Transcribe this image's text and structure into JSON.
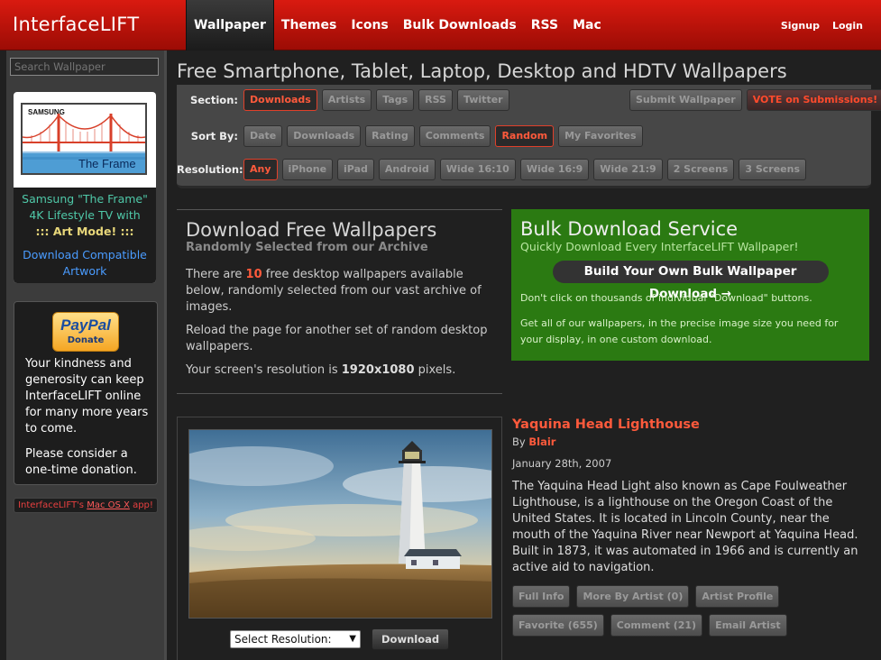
{
  "header": {
    "logo": "InterfaceLIFT",
    "nav": [
      "Wallpaper",
      "Themes",
      "Icons",
      "Bulk Downloads",
      "RSS",
      "Mac"
    ],
    "signup": "Signup",
    "login": "Login"
  },
  "sidebar": {
    "search_placeholder": "Search Wallpaper",
    "ad": {
      "brand": "SAMSUNG",
      "product": "The Frame",
      "line1": "Samsung \"The Frame\"",
      "line2": "4K Lifestyle TV with",
      "line3": "::: Art Mode! :::",
      "link": "Download Compatible Artwork"
    },
    "paypal": {
      "logo": "PayPal",
      "donate": "Donate"
    },
    "donate_p1": "Your kindness and generosity can keep InterfaceLIFT online for many more years to come.",
    "donate_p2": "Please consider a one-time donation.",
    "mac_prefix": "InterfaceLIFT's ",
    "mac_link": "Mac OS X",
    "mac_suffix": " app!"
  },
  "page_title": "Free Smartphone, Tablet, Laptop, Desktop and HDTV Wallpapers",
  "filters": {
    "section_label": "Section:",
    "section": [
      "Downloads",
      "Artists",
      "Tags",
      "RSS",
      "Twitter"
    ],
    "submit": "Submit Wallpaper",
    "vote": "VOTE on Submissions!",
    "sort_label": "Sort By:",
    "sort": [
      "Date",
      "Downloads",
      "Rating",
      "Comments",
      "Random",
      "My Favorites"
    ],
    "res_label": "Resolution:",
    "resolution": [
      "Any",
      "iPhone",
      "iPad",
      "Android",
      "Wide 16:10",
      "Wide 16:9",
      "Wide 21:9",
      "2 Screens",
      "3 Screens"
    ]
  },
  "intro": {
    "title": "Download Free Wallpapers",
    "subtitle": "Randomly Selected from our Archive",
    "p1_a": "There are ",
    "p1_num": "10",
    "p1_b": " free desktop wallpapers available below, randomly selected from our vast archive of images.",
    "p2": "Reload the page for another set of random desktop wallpapers.",
    "p3_a": "Your screen's resolution is ",
    "p3_res": "1920x1080",
    "p3_b": " pixels."
  },
  "bulk": {
    "title": "Bulk Download Service",
    "subtitle": "Quickly Download Every InterfaceLIFT Wallpaper!",
    "button": "Build Your Own Bulk Wallpaper Download →",
    "p1": "Don't click on thousands of individual \"Download\" buttons.",
    "p2": "Get all of our wallpapers, in the precise image size you need for your display, in one custom download."
  },
  "wallpaper": {
    "select_label": "Select Resolution:",
    "download": "Download",
    "title": "Yaquina Head Lighthouse",
    "by": "By ",
    "author": "Blair",
    "date": "January 28th, 2007",
    "description": "The Yaquina Head Light also known as Cape Foulweather Lighthouse, is a lighthouse on the Oregon Coast of the United States. It is located in Lincoln County, near the mouth of the Yaquina River near Newport at Yaquina Head. Built in 1873, it was automated in 1966 and is currently an active aid to navigation.",
    "buttons_row1": [
      "Full Info",
      "More By Artist (0)",
      "Artist Profile"
    ],
    "buttons_row2": [
      "Favorite (655)",
      "Comment (21)",
      "Email Artist"
    ]
  },
  "colors": {
    "accent": "#ff5a3c",
    "header_red": "#d91a10",
    "bulk_green": "#2b7a12"
  }
}
